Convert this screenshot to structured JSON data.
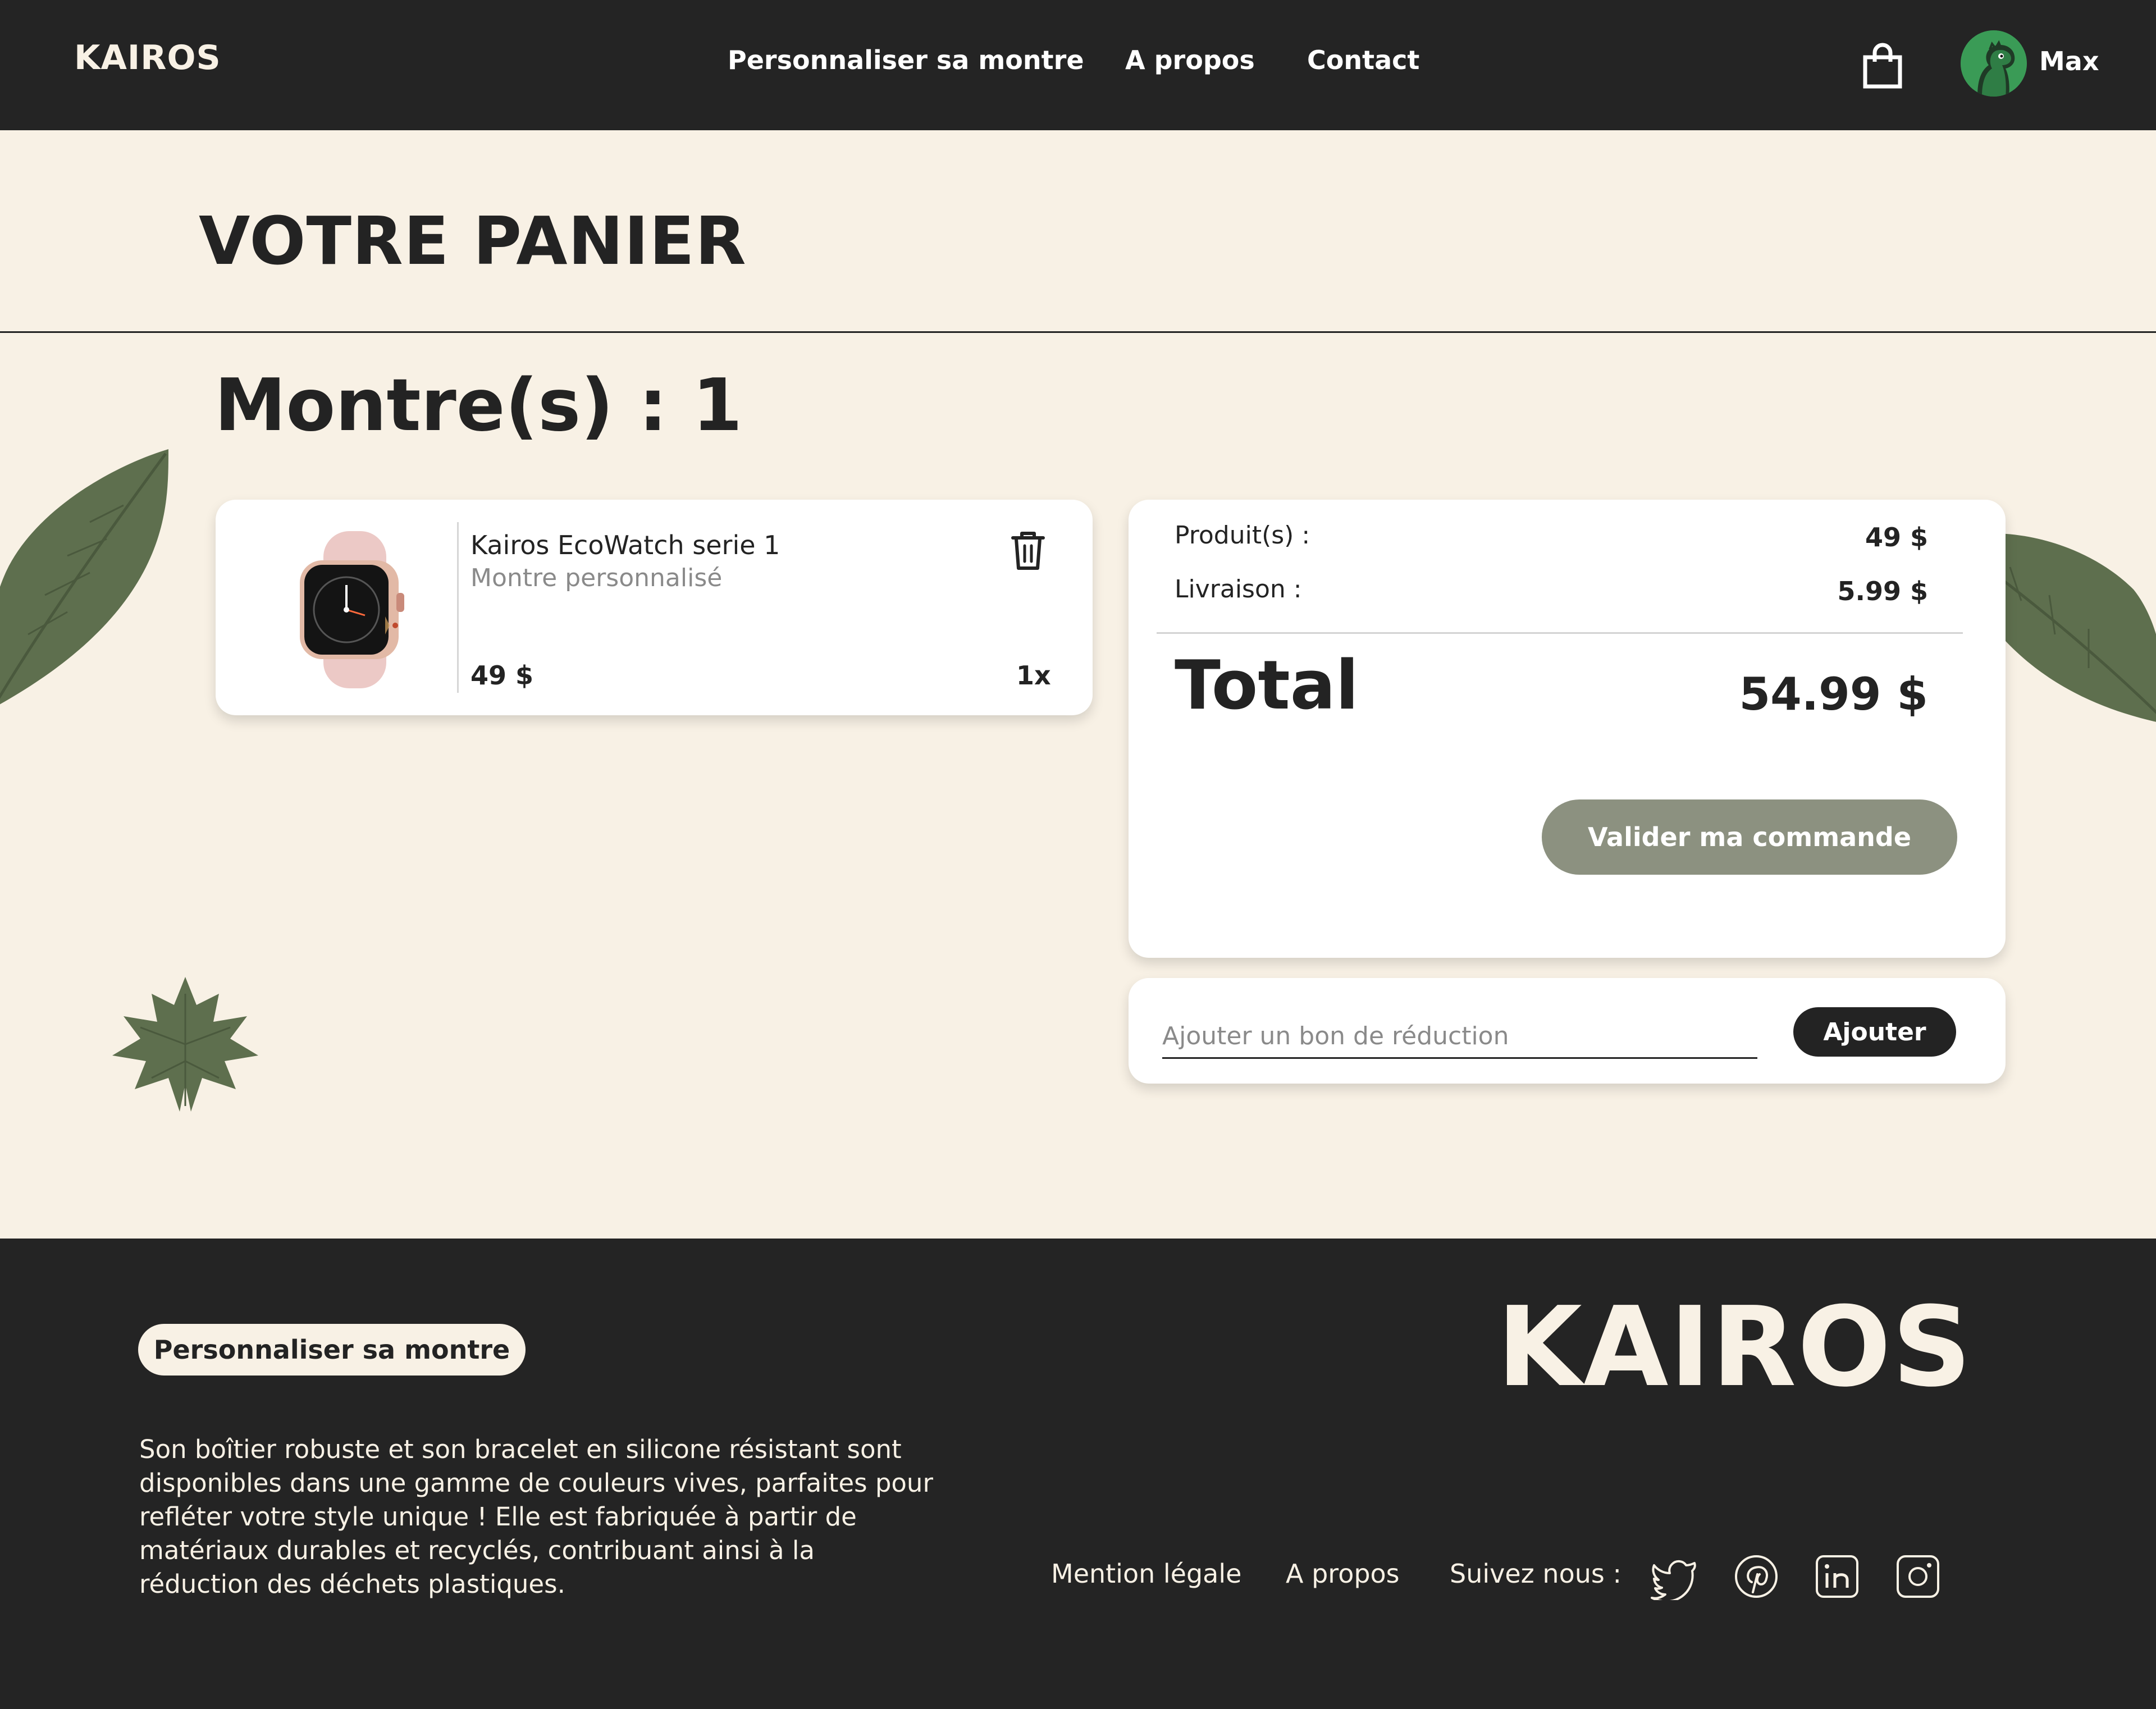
{
  "header": {
    "logo": "KAIROS",
    "nav": [
      "Personnaliser sa montre",
      "A propos",
      "Contact"
    ],
    "user_name": "Max",
    "icons": {
      "cart": "shopping-bag-icon",
      "avatar": "dinosaur-avatar"
    }
  },
  "page": {
    "title": "VOTRE PANIER",
    "count_label": "Montre(s) : 1"
  },
  "cart": {
    "items": [
      {
        "name": "Kairos EcoWatch serie 1",
        "subtitle": "Montre personnalisé",
        "price": "49 $",
        "quantity": "1x",
        "icon": "trash-icon"
      }
    ]
  },
  "summary": {
    "products_label": "Produit(s) :",
    "products_value": "49 $",
    "shipping_label": "Livraison :",
    "shipping_value": "5.99 $",
    "total_label": "Total",
    "total_value": "54.99 $",
    "validate_label": "Valider ma commande"
  },
  "coupon": {
    "placeholder": "Ajouter un bon de réduction",
    "button_label": "Ajouter"
  },
  "footer": {
    "pill_label": "Personnaliser sa montre",
    "description": "Son boîtier robuste et son bracelet en silicone résistant sont disponibles dans une gamme de couleurs vives, parfaites pour refléter votre style unique ! Elle est fabriquée à partir de matériaux durables et recyclés, contribuant ainsi à la réduction des déchets plastiques.",
    "logo": "KAIROS",
    "links": [
      "Mention légale",
      "A propos",
      "Suivez nous :"
    ],
    "social_icons": [
      "twitter-icon",
      "pinterest-icon",
      "linkedin-icon",
      "instagram-icon"
    ]
  },
  "colors": {
    "background": "#f8f1e5",
    "dark": "#242424",
    "accent_button": "#8c9180",
    "leaf": "#5e6f4e"
  }
}
